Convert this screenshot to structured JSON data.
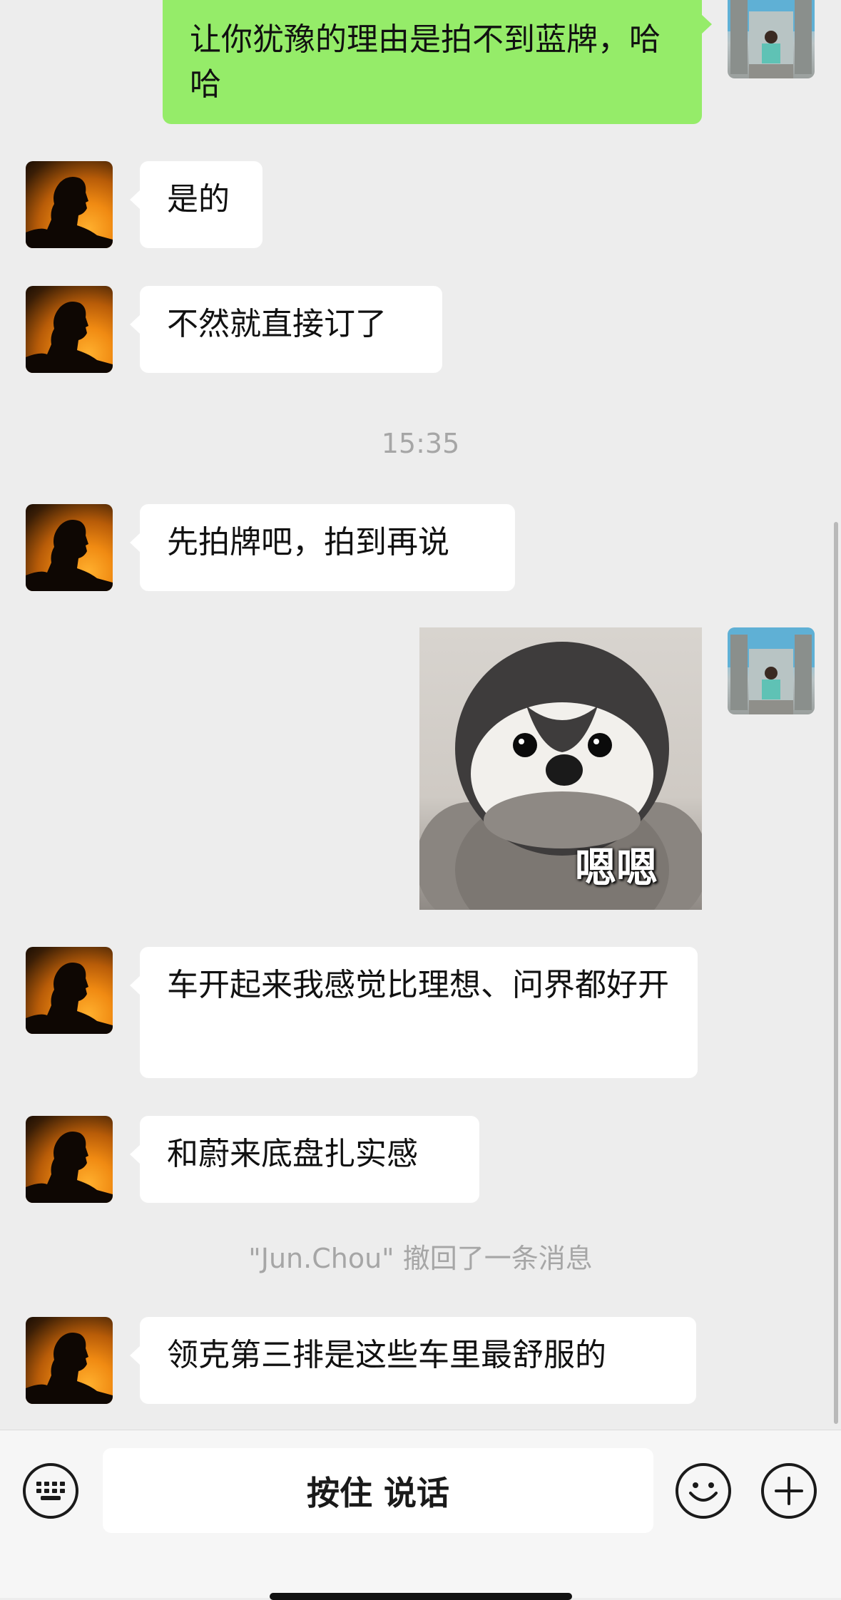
{
  "messages": [
    {
      "side": "out",
      "text": "让你犹豫的理由是拍不到蓝牌，哈哈"
    },
    {
      "side": "in",
      "text": "是的"
    },
    {
      "side": "in",
      "text": "不然就直接订了"
    },
    {
      "side": "in",
      "text": "先拍牌吧，拍到再说"
    },
    {
      "side": "out",
      "type": "sticker",
      "caption": "嗯嗯"
    },
    {
      "side": "in",
      "text": "车开起来我感觉比理想、问界都好开"
    },
    {
      "side": "in",
      "text": "和蔚来底盘扎实感"
    },
    {
      "side": "in",
      "text": "领克第三排是这些车里最舒服的"
    }
  ],
  "timestamp": "15:35",
  "recall_notice": "\"Jun.Chou\" 撤回了一条消息",
  "input_bar": {
    "hold_to_talk": "按住 说话",
    "left_icon": "keyboard-icon",
    "emoji_icon": "emoji-icon",
    "plus_icon": "plus-icon"
  },
  "colors": {
    "background": "#ededed",
    "outgoing_bubble": "#95ec69",
    "incoming_bubble": "#ffffff",
    "system_text": "#a6a6a6"
  }
}
